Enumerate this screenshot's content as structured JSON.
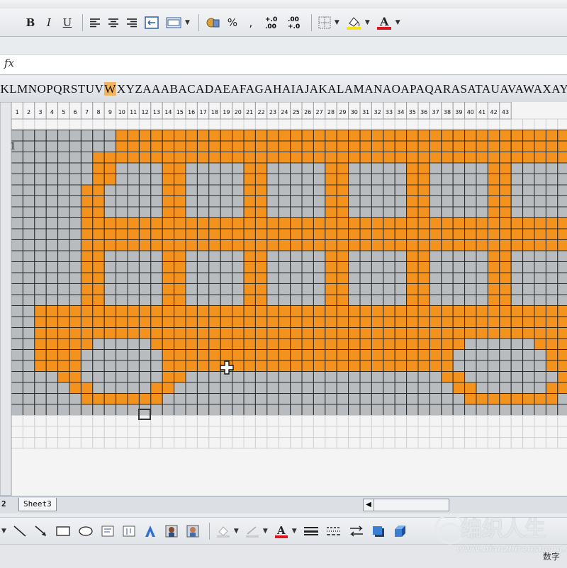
{
  "toolbar": {
    "bold": "B",
    "italic": "I",
    "underline": "U",
    "percent": "%",
    "comma": ",",
    "inc_decimal": ".0\n.00",
    "dec_decimal": ".00\n+.0",
    "icons": [
      "align-left-icon",
      "align-center-icon",
      "align-right-icon",
      "merge-center-icon",
      "currency-icon",
      "borders-icon",
      "fill-color-icon",
      "font-color-icon"
    ],
    "font_color_label": "A",
    "fill_color": "#f7e117",
    "font_color": "#e0141e"
  },
  "formula_bar": {
    "fx_label": "fx",
    "value": ""
  },
  "columns": {
    "pre": "KLMNOPQRSTUV",
    "selected": "W",
    "post": "XYZAAABACADAEAFAGAHAIAJAKALAMANAOAPAQARASATAUAVAWAXAYAZBABBBCBDBEBFBG"
  },
  "row_label": "1",
  "grid": {
    "cell_numbers": [
      "1",
      "2",
      "3",
      "4",
      "5",
      "6",
      "7",
      "8",
      "9",
      "10",
      "11",
      "12",
      "13",
      "14",
      "15",
      "16",
      "17",
      "18",
      "19",
      "20",
      "21",
      "22",
      "23",
      "24",
      "25",
      "26",
      "27",
      "28",
      "29",
      "30",
      "31",
      "32",
      "33",
      "34",
      "35",
      "36",
      "37",
      "38",
      "39",
      "40",
      "41",
      "42",
      "43"
    ],
    "colors": {
      "orange": "#f4921e",
      "light": "#f8a534",
      "gray": "#b9bcbf",
      "white": "#f4f4f4",
      "line": "#2a2a2a"
    },
    "pattern": [
      "WWWWWWWWWWWWWWWWWWWWWWWWWWWWWWWWWWWWWWWWWWWWWWWWWWWW",
      "GGGGGGGGGOOOOOOOOOOOOOOOOOOOOOOOOOOOOOOOOOOOOOOOOOGGGGG",
      "GGGGGGGGGOOOOOOOOOOOOOOOOOOOOOOOOOOOOOOOOOOOOOOOOOGGGGG",
      "GGGGGGGOOOOOOOOOOOOOOOOOOOOOOOOOOOOOOOOOOOOOOOOOOOGGGGG",
      "GGGGGGGOOGGGGOOGGGGGOOGGGGGOOGGGGGOOGGGGGOOGGGGGOOOGGGG",
      "GGGGGGGOOGGGGOOGGGGGOOGGGGGOOGGGGGOOGGGGGOOGGGGGOOOGGGG",
      "GGGGGGOOGGGGGOOGGGGGOOGGGGGOOGGGGGOOGGGGGOOGGGGGOOOOGGGG",
      "GGGGGGOOGGGGGOOGGGGGOOGGGGGOOGGGGGOOGGGGGOOGGGGGOOOOGGGG",
      "GGGGGGOOGGGGGOOGGGGGOOGGGGGOOGGGGGOOGGGGGOOGGGGGOOOOGGGG",
      "GGGGGGOOOOOOOOOOOOOOOOOOOOOOOOOOOOOOOOOOOOOOOOOOOOOOGGGG",
      "GGGGGGOOOOOOOOOOOOOOOOOOOOOOOOOOOOOOOOOOOOOOOOOOOOOOGGGG",
      "GGGGGGOOOOOOOOOOOOOOOOOOOOOOOOOOOOOOOOOOOOOOOOOOOOOOGGGG",
      "GGGGGGOOGGGGGOOGGGGGOOGGGGGOOGGGGGOOGGGGGOOGGGGGOOOOGGGG",
      "GGGGGGOOGGGGGOOGGGGGOOGGGGGOOGGGGGOOGGGGGOOGGGGGOOOOGGGG",
      "GGGGGGOOGGGGGOOGGGGGOOGGGGGOOGGGGGOOGGGGGOOGGGGGOOOOGGGG",
      "GGGGGGOOGGGGGOOGGGGGOOGGGGGOOGGGGGOOGGGGGOOGGGGGOOOOGGGG",
      "GGGGGGOOGGGGGOOGGGGGOOGGGGGOOGGGGGOOGGGGGOOGGGGGOOOOGGGG",
      "GGOOOOOOOOOOOOOOOOOOOOOOOOOOOOOOOOOOOOOOOOOOOOOOOOOOGGGG",
      "GGOOOOOOOOOOOOOOOOOOOOOOOOOOOOOOOOOOOOOOOOOOOOOOOOOOGGGG",
      "GGOOOOOOOOOOOOOOOOOOOOOOOOOOOOOOOOOOOOOOOOOOOOOOOOOOGGGG",
      "GGOOOOOGGGGGOOOOOOOOOOOOOOOOOOOOOOOOOOOGGGGGGOOOOOOOGGGG",
      "GGOOOOGGGGGGGOOOOOOOOOOOOOOOOOOOOOOOOOGGGGGGGGOOOOOOGGGG",
      "GGOOOOGGGGGGGOOOOOOOOOOOOOOOOOOOOOOOOOGGGGGGGGOOOOOOGGGG",
      "GGGGOOGGGGGGGOOGGGGGGGGGGGGGGGGGGGGGGOOGGGGGGGGOOGGGGGGGG",
      "GGGGGOOGGGGGOOGGGGGGGGGGGGGGGGGGGGGGGGOOGGGGGGOOGGGGGGGGG",
      "GGGGGGOOOOOOOGGGGGGGGGGGGGGGGGGGGGGGGGGOOOOOOOOGGGGGGGGGG",
      "GGGGGGGGGGGGGGGGGGGGGGGGGGGGGGGGGGGGGGGGGGGGGGGGGGGGGGGGG",
      "WWWWWWWWWWWWWWWWWWWWWWWWWWWWWWWWWWWWWWWWWWWWWWWWWWWWWWWWW",
      "WWWWWWWWWWWWWWWWWWWWWWWWWWWWWWWWWWWWWWWWWWWWWWWWWWWWWWWWW",
      "WWWWWWWWWWWWWWWWWWWWWWWWWWWWWWWWWWWWWWWWWWWWWWWWWWWWWWWWW"
    ]
  },
  "sheet_tabs": {
    "prev": "2",
    "current": "Sheet3"
  },
  "drawing_bar": {
    "icons": [
      "draw-dropdown-icon",
      "line-icon",
      "arrow-icon",
      "rectangle-icon",
      "oval-icon",
      "textbox-icon",
      "vertical-textbox-icon",
      "wordart-icon",
      "clipart-icon",
      "picture-icon",
      "fill-color-icon",
      "line-color-icon",
      "font-color-icon",
      "line-style-icon",
      "dash-style-icon",
      "arrow-style-icon",
      "shadow-icon",
      "3d-icon"
    ],
    "font_color_label": "A"
  },
  "status": {
    "mode": "数字"
  },
  "watermark": {
    "text_cn": "编织人生",
    "url": "www.bianzhirensheng.com"
  }
}
